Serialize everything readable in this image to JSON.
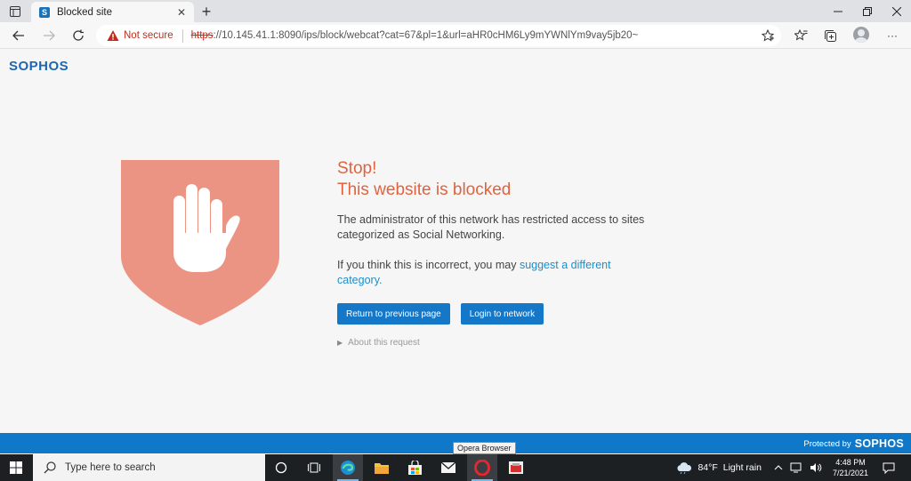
{
  "browser": {
    "tab": {
      "favicon_letter": "S",
      "title": "Blocked site",
      "close_glyph": "✕"
    },
    "new_tab_glyph": "+",
    "address": {
      "security_label": "Not secure",
      "url_scheme": "https",
      "url_rest": "://10.145.41.1:8090/ips/block/webcat?cat=67&pl=1&url=aHR0cHM6Ly9mYWNlYm9vay5jb20~"
    },
    "more_glyph": "···"
  },
  "page": {
    "brand": "SOPHOS",
    "heading_line1": "Stop!",
    "heading_line2": "This website is blocked",
    "paragraph1": "The administrator of this network has restricted access to sites categorized as Social Networking.",
    "paragraph2_prefix": "If you think this is incorrect, you may ",
    "paragraph2_link": "suggest a different category.",
    "buttons": {
      "back": "Return to previous page",
      "login": "Login to network"
    },
    "about_link": "About this request",
    "colors": {
      "accent": "#e0633f",
      "shield": "#ec9484",
      "button": "#1577c8",
      "link": "#1a8fcf"
    }
  },
  "footer": {
    "protected_by": "Protected by",
    "protected_logo": "SOPHOS"
  },
  "tooltip": "Opera Browser",
  "taskbar": {
    "search_placeholder": "Type here to search",
    "weather_temp": "84°F",
    "weather_desc": "Light rain",
    "time": "4:48 PM",
    "date": "7/21/2021"
  },
  "icons": [
    "tab-actions-icon",
    "favicon-icon",
    "close-icon",
    "plus-icon",
    "minimize-icon",
    "maximize-icon",
    "window-close-icon",
    "back-icon",
    "forward-icon",
    "refresh-icon",
    "warning-icon",
    "favorite-star-icon",
    "favorites-icon",
    "collections-icon",
    "profile-icon",
    "more-icon",
    "hand-stop-icon",
    "windows-start-icon",
    "search-icon",
    "task-view-icon",
    "edge-icon",
    "file-explorer-icon",
    "store-icon",
    "mail-icon",
    "opera-icon",
    "app-icon",
    "cloud-rain-icon",
    "chevron-up-icon",
    "network-icon",
    "volume-icon",
    "notification-icon"
  ]
}
